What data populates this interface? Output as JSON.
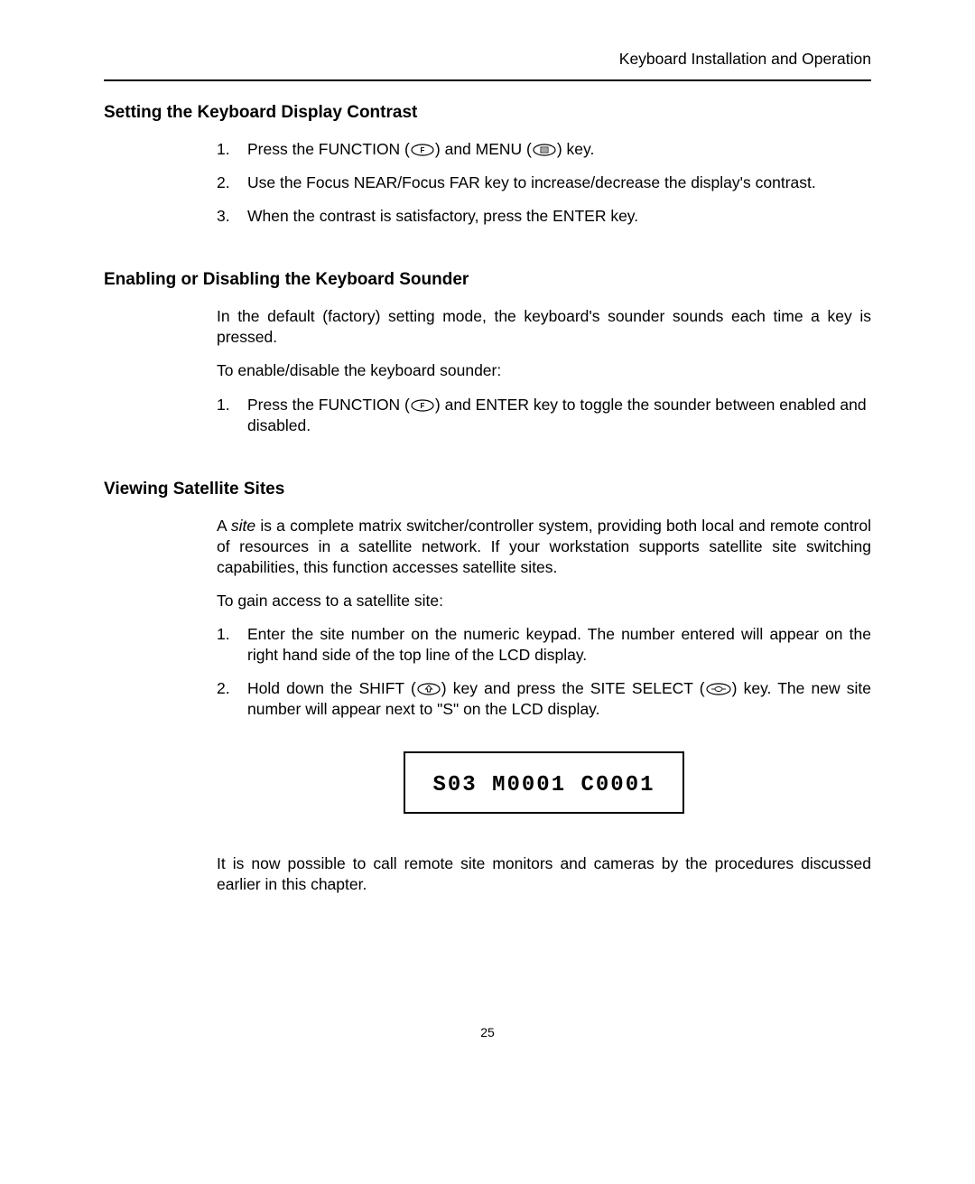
{
  "header": "Keyboard Installation and Operation",
  "s1": {
    "heading": "Setting the Keyboard Display Contrast",
    "step1a": "Press the FUNCTION (",
    "step1b": ") and MENU (",
    "step1c": ") key.",
    "step2": "Use the Focus NEAR/Focus FAR key to increase/decrease the display's contrast.",
    "step3": "When the contrast is satisfactory, press the ENTER key."
  },
  "s2": {
    "heading": "Enabling or Disabling the Keyboard Sounder",
    "p1": "In the default (factory) setting mode, the keyboard's sounder sounds each time a key is pressed.",
    "p2": "To enable/disable the keyboard sounder:",
    "step1a": "Press the FUNCTION (",
    "step1b": ") and ENTER key to toggle the sounder between enabled and disabled."
  },
  "s3": {
    "heading": "Viewing Satellite Sites",
    "p1a": "A ",
    "site": "site",
    "p1b": " is a complete matrix switcher/controller system, providing both local and remote control of resources in a satellite network. If your workstation supports satellite site switching capabilities, this function accesses satellite sites.",
    "p2": "To gain access to a satellite site:",
    "step1": "Enter the site number on the numeric keypad. The number entered will appear on the right hand side of the top line of the LCD display.",
    "step2a": "Hold down the SHIFT (",
    "step2b": ") key and press the SITE SELECT (",
    "step2c": ") key. The new site number will appear next to \"S\" on the LCD display.",
    "lcd": "S03 M0001 C0001",
    "p3": "It is now possible to call remote site monitors and cameras by the procedures discussed earlier in this chapter."
  },
  "pageNumber": "25"
}
